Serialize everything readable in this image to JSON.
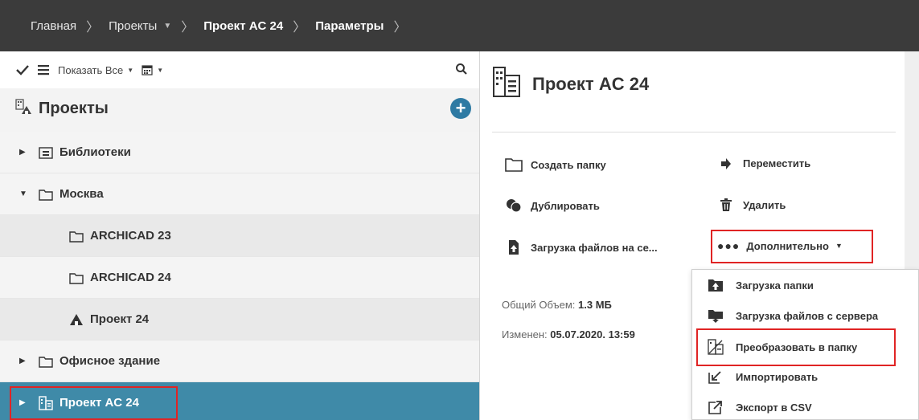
{
  "breadcrumb": {
    "items": [
      {
        "label": "Главная"
      },
      {
        "label": "Проекты"
      },
      {
        "label": "Проект AC 24"
      },
      {
        "label": "Параметры"
      }
    ]
  },
  "toolbar": {
    "show_all_label": "Показать Все"
  },
  "projects_panel": {
    "title": "Проекты"
  },
  "tree": {
    "items": [
      {
        "label": "Библиотеки"
      },
      {
        "label": "Москва"
      },
      {
        "label": "ARCHICAD 23"
      },
      {
        "label": "ARCHICAD 24"
      },
      {
        "label": "Проект 24"
      },
      {
        "label": "Офисное здание"
      },
      {
        "label": "Проект AC 24"
      }
    ]
  },
  "detail": {
    "title": "Проект AC 24",
    "actions": {
      "create_folder": "Создать папку",
      "move": "Переместить",
      "duplicate": "Дублировать",
      "delete": "Удалить",
      "upload_files": "Загрузка файлов на се...",
      "more": "Дополнительно"
    },
    "info": {
      "total_size_label": "Общий Объем:",
      "total_size_value": "1.3 МБ",
      "modified_label": "Изменен:",
      "modified_value": "05.07.2020. 13:59"
    }
  },
  "menu": {
    "items": [
      {
        "label": "Загрузка папки",
        "icon": "folder-upload-icon"
      },
      {
        "label": "Загрузка файлов с сервера",
        "icon": "file-download-icon"
      },
      {
        "label": "Преобразовать в папку",
        "icon": "convert-to-folder-icon"
      },
      {
        "label": "Импортировать",
        "icon": "import-icon"
      },
      {
        "label": "Экспорт в CSV",
        "icon": "export-csv-icon"
      }
    ]
  },
  "colors": {
    "topbar": "#3b3b3b",
    "selected_row": "#3f8aa8",
    "accent_blue": "#2e7aa3",
    "highlight_red": "#e02424"
  }
}
